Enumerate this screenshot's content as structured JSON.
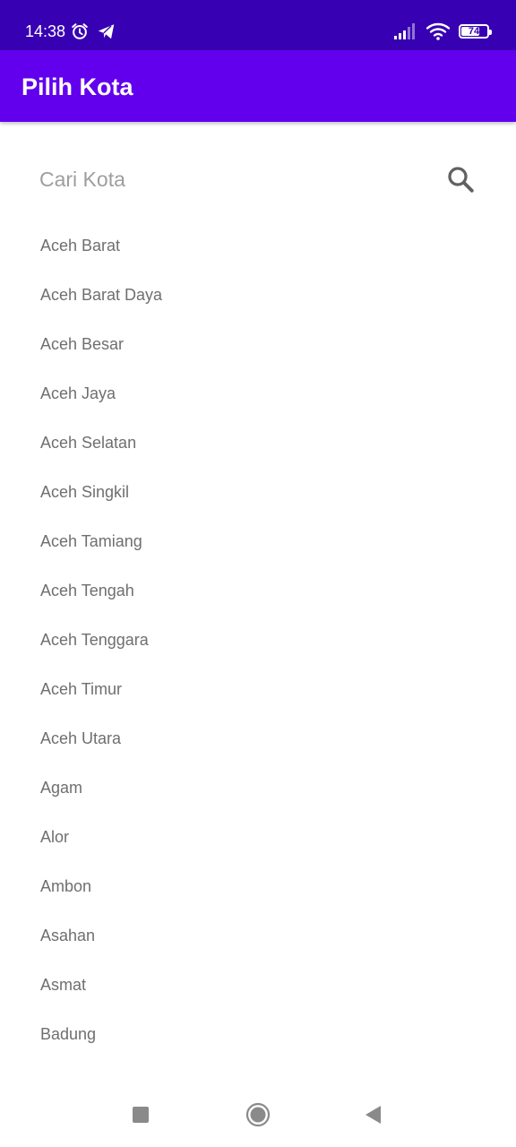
{
  "status_bar": {
    "time": "14:38",
    "battery_level": "74",
    "icons": [
      "alarm-icon",
      "telegram-icon",
      "signal-icon",
      "wifi-icon",
      "battery-icon"
    ]
  },
  "app_bar": {
    "title": "Pilih Kota",
    "color": "#6200ee",
    "status_color": "#3700b3"
  },
  "search": {
    "placeholder": "Cari Kota",
    "value": "",
    "icon": "search-icon"
  },
  "cities": [
    "Aceh Barat",
    "Aceh Barat Daya",
    "Aceh Besar",
    "Aceh Jaya",
    "Aceh Selatan",
    "Aceh Singkil",
    "Aceh Tamiang",
    "Aceh Tengah",
    "Aceh Tenggara",
    "Aceh Timur",
    "Aceh Utara",
    "Agam",
    "Alor",
    "Ambon",
    "Asahan",
    "Asmat",
    "Badung"
  ],
  "nav_bar": {
    "icons": [
      "recents-square-icon",
      "home-circle-icon",
      "back-triangle-icon"
    ]
  }
}
